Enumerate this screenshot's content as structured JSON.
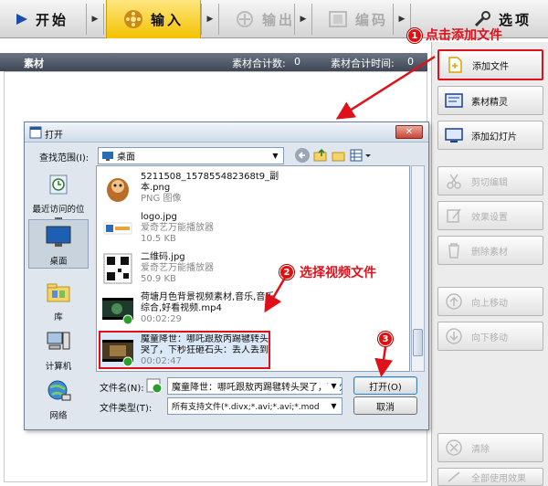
{
  "toolbar": {
    "start": "开始",
    "input": "输入",
    "output": "输出",
    "edit": "编码",
    "options": "选项"
  },
  "header": {
    "title": "素材",
    "count_label": "素材合计数:",
    "count_value": "0",
    "time_label": "素材合计时间:",
    "time_value": "0"
  },
  "right_panel": {
    "buttons": [
      {
        "label": "添加文件",
        "icon": "add-file-icon",
        "enabled": true
      },
      {
        "label": "素材精灵",
        "icon": "wizard-icon",
        "enabled": true
      },
      {
        "label": "添加幻灯片",
        "icon": "slideshow-icon",
        "enabled": true
      },
      {
        "label": "剪切编辑",
        "icon": "scissors-icon",
        "enabled": false
      },
      {
        "label": "效果设置",
        "icon": "effect-icon",
        "enabled": false
      },
      {
        "label": "删除素材",
        "icon": "trash-icon",
        "enabled": false
      },
      {
        "label": "向上移动",
        "icon": "arrow-up-icon",
        "enabled": false
      },
      {
        "label": "向下移动",
        "icon": "arrow-down-icon",
        "enabled": false
      },
      {
        "label": "清除",
        "icon": "clear-icon",
        "enabled": false
      },
      {
        "label": "全部使用效果",
        "icon": "apply-all-icon",
        "enabled": false
      }
    ]
  },
  "dialog": {
    "title": "打开",
    "look_in_label": "查找范围(I):",
    "look_in_value": "桌面",
    "places": [
      {
        "label": "最近访问的位置"
      },
      {
        "label": "桌面"
      },
      {
        "label": "库"
      },
      {
        "label": "计算机"
      },
      {
        "label": "网络"
      }
    ],
    "files": [
      {
        "name1": "5211508_157855482368t9_副",
        "name2": "本.png",
        "meta1": "PNG 图像",
        "meta2": ""
      },
      {
        "name1": "logo.jpg",
        "name2": "",
        "meta1": "爱奇艺万能播放器",
        "meta2": "10.5 KB"
      },
      {
        "name1": "二维码.jpg",
        "name2": "",
        "meta1": "爱奇艺万能播放器",
        "meta2": "50.9 KB"
      },
      {
        "name1": "荷塘月色背景视频素材,音乐,音乐",
        "name2": "综合,好看视频.mp4",
        "meta1": "00:02:29",
        "meta2": ""
      },
      {
        "name1": "魔童降世：哪吒跟敖丙踢毽转头",
        "name2": "哭了，下秒狂砸石头：丢人丢到...",
        "meta1": "00:02:47",
        "meta2": ""
      }
    ],
    "filename_label": "文件名(N):",
    "filename_value": "魔童降世：哪吒跟敖丙踢毽转头哭了，下秒",
    "filetype_label": "文件类型(T):",
    "filetype_value": "所有支持文件(*.divx;*.avi;*.avi;*.mod",
    "open_button": "打开(O)",
    "cancel_button": "取消"
  },
  "annotations": {
    "step1_num": "1",
    "step1_text": "点击添加文件",
    "step2_num": "2",
    "step2_text": "选择视频文件",
    "step3_num": "3"
  },
  "colors": {
    "annotation": "#e0101a",
    "active_tab": "#f3c200"
  }
}
